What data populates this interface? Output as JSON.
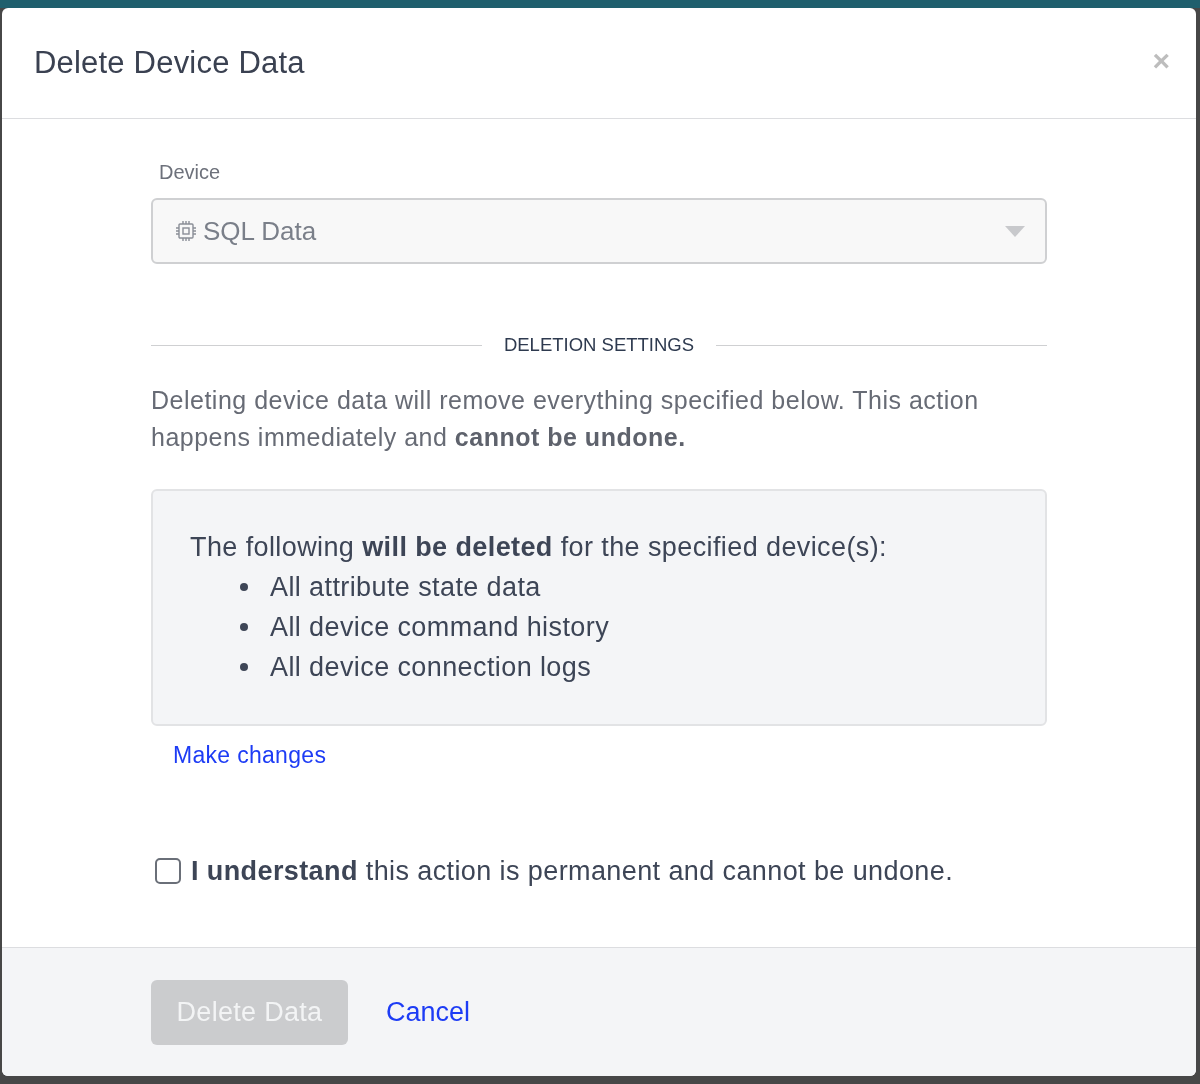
{
  "modal": {
    "title": "Delete Device Data",
    "close": "×"
  },
  "device_field": {
    "label": "Device",
    "value": "SQL Data",
    "disabled": true
  },
  "section": {
    "heading": "DELETION SETTINGS"
  },
  "warning": "Deleting device data will remove everything specified below. This action happens immediately and **cannot be undone.**",
  "summary": {
    "intro": "The following **will be deleted** for the specified device(s):",
    "items": [
      "All attribute state data",
      "All device command history",
      "All device connection logs"
    ]
  },
  "make_changes_link": "Make changes",
  "confirm": {
    "label": "**I understand** this action is permanent and cannot be undone.",
    "checked": false
  },
  "footer": {
    "buttons": [
      {
        "label": "Delete Data",
        "kind": "primary",
        "disabled": true
      },
      {
        "label": "Cancel",
        "kind": "link",
        "disabled": false
      }
    ]
  }
}
